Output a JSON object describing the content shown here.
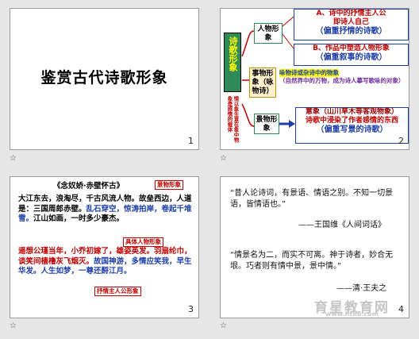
{
  "slides": [
    {
      "number": "1",
      "title": "鉴赏古代诗歌形象"
    },
    {
      "number": "2",
      "center": "诗歌形象",
      "side_note": "情以象生意在象中物象是感情的载体",
      "branch_person": "人物形象",
      "branch_thing": "事物形象（咏物诗）",
      "branch_scene": "景物形象",
      "person_a_line1": "A、诗中的抒情主人公",
      "person_a_line2": "即诗人自己",
      "person_a_note": "（偏重抒情的诗歌）",
      "person_b_line1": "B、作品中塑造人物形象",
      "person_b_note": "（偏重叙事的诗歌）",
      "thing_line1": "咏物诗或杂诗中的物象",
      "thing_line2": "（自然界中的万物，成为诗人摹写歌咏的对象）",
      "scene_line1": "意象（山川草木等客观物象）",
      "scene_line2": "诗歌中浸染了作者感情的东西",
      "scene_note": "（偏重写景的诗歌）"
    },
    {
      "number": "3",
      "poem_title": "《念奴娇·赤壁怀古》",
      "stanza1": "大江东去，浪淘尽，千古风流人物。故垒西边，人道是：三国周郎赤壁。",
      "stanza1_blue": "乱石穿空，惊涛拍岸，卷起千堆雪。",
      "stanza1_end": "江山如画，一时多少豪杰。",
      "stanza2_red": "遥想公瑾当年，小乔初嫁了，雄姿英发。羽扇纶巾，谈笑间樯橹灰飞烟灭。",
      "stanza2_blue": "故国神游，多情应笑我，早生华发。人生如梦，一尊还酹江月。",
      "tag_scene": "景物形象",
      "tag_person": "具体人物形象",
      "tag_lyric": "抒情主人公形象"
    },
    {
      "number": "4",
      "quote1": "“昔人论诗词，有景语、情语之别。不知一切景语，皆情语也。”",
      "author1": "——王国维《人间词话》",
      "quote2": "“情景名为二，而实不可离。神于诗者，妙合无垠。巧者则有情中景，景中情。”",
      "author2": "——清·王夫之",
      "watermark_cn": "育星教育网",
      "watermark_url": "www.ht88.com"
    }
  ],
  "colors": {
    "red": "#c00000",
    "blue": "#1f3fa8",
    "darkred": "#990000",
    "green": "#2e8b57",
    "purple": "#7030a0"
  }
}
